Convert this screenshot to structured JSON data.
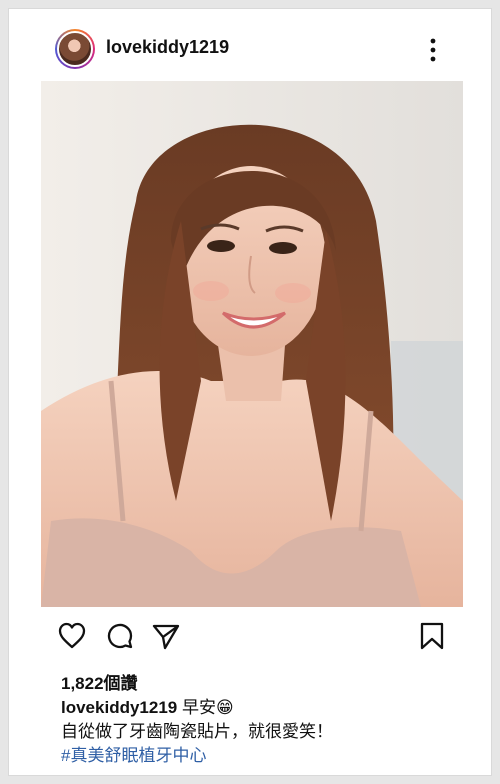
{
  "post": {
    "username": "lovekiddy1219",
    "likes": "1,822個讚",
    "caption_user": "lovekiddy1219",
    "caption_text": " 早安",
    "caption_emoji": "😁",
    "caption_line2": "自從做了牙齒陶瓷貼片，就很愛笑！",
    "hashtag": "#真美舒眠植牙中心"
  },
  "icons": {
    "more": "more-vertical-icon",
    "like": "heart-icon",
    "comment": "comment-icon",
    "share": "send-icon",
    "save": "bookmark-icon"
  }
}
